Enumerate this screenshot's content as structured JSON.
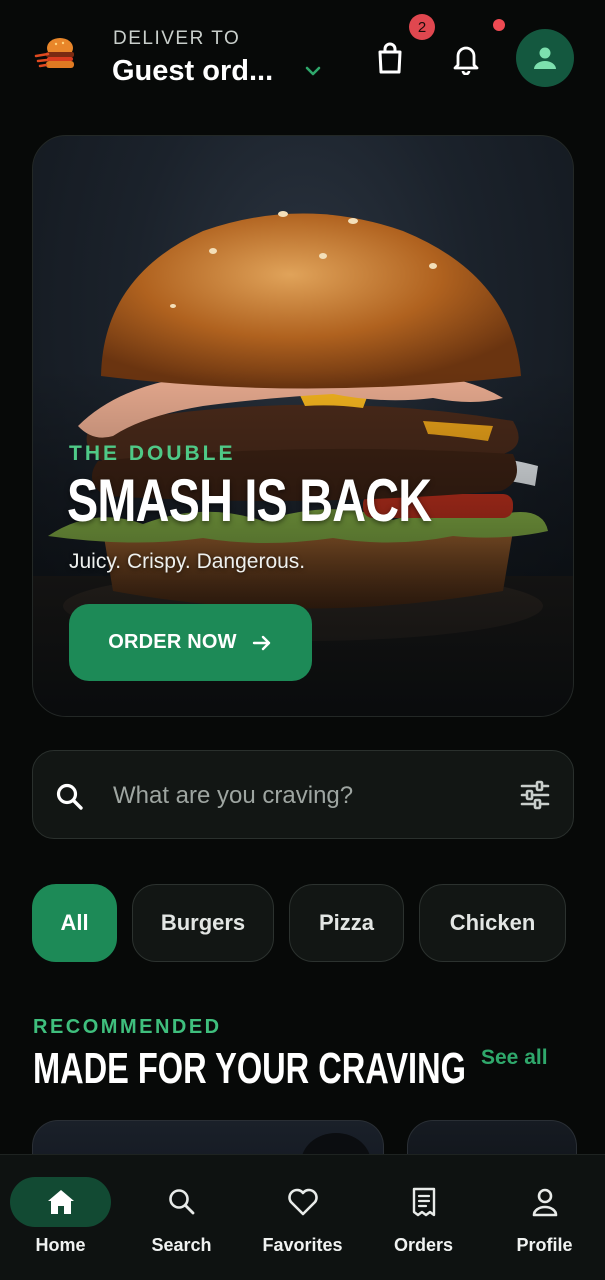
{
  "header": {
    "deliver_label": "DELIVER TO",
    "deliver_value": "Guest ord...",
    "cart_badge_count": "2",
    "logo_icon": "burger-logo-icon",
    "icons": [
      "chevron-down-icon",
      "shopping-bag-icon",
      "bell-icon",
      "user-icon"
    ]
  },
  "hero": {
    "eyebrow": "THE DOUBLE",
    "title": "SMASH IS BACK",
    "subtitle": "Juicy. Crispy. Dangerous.",
    "cta_label": "ORDER NOW",
    "cta_icon": "arrow-right-icon"
  },
  "search": {
    "placeholder": "What are you craving?",
    "value": "",
    "icons": [
      "search-icon",
      "sliders-icon"
    ]
  },
  "categories": {
    "items": [
      {
        "label": "All",
        "active": true
      },
      {
        "label": "Burgers",
        "active": false
      },
      {
        "label": "Pizza",
        "active": false
      },
      {
        "label": "Chicken",
        "active": false
      }
    ]
  },
  "recommended": {
    "eyebrow": "RECOMMENDED",
    "title": "MADE FOR YOUR CRAVING",
    "see_all_label": "See all"
  },
  "bottom_nav": {
    "items": [
      {
        "label": "Home",
        "icon": "home-icon",
        "active": true
      },
      {
        "label": "Search",
        "icon": "search-icon",
        "active": false
      },
      {
        "label": "Favorites",
        "icon": "heart-icon",
        "active": false
      },
      {
        "label": "Orders",
        "icon": "receipt-icon",
        "active": false
      },
      {
        "label": "Profile",
        "icon": "user-icon",
        "active": false
      }
    ]
  },
  "colors": {
    "background": "#070908",
    "accent": "#1d8a57",
    "accent_text": "#3fbf7d",
    "badge": "#e0474f"
  }
}
